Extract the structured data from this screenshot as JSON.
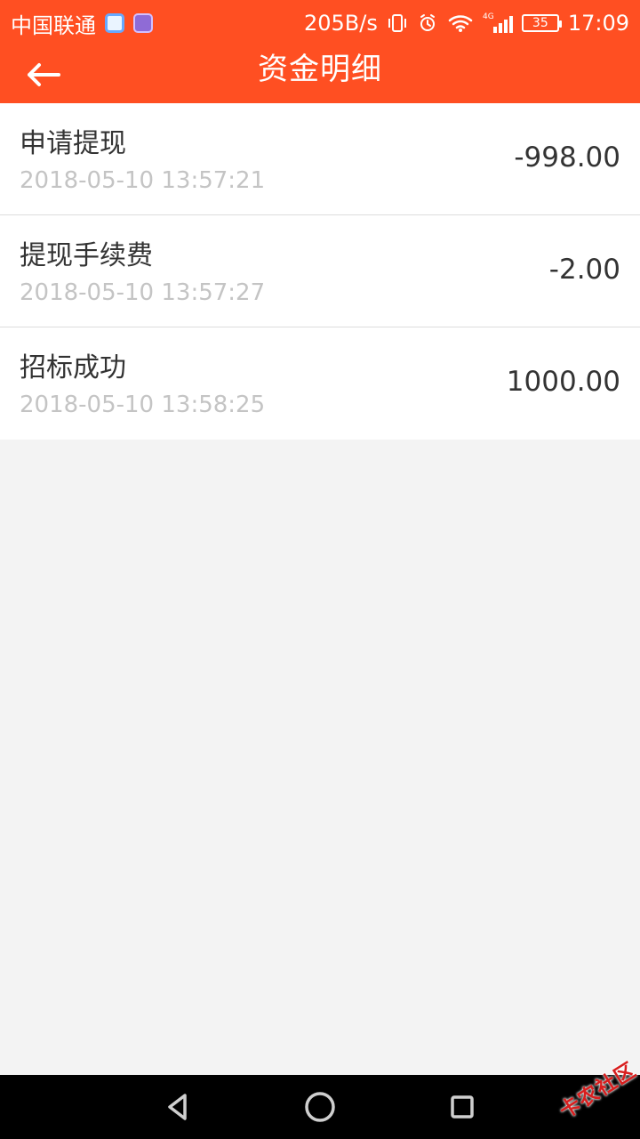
{
  "status_bar": {
    "carrier": "中国联通",
    "speed": "205B/s",
    "network": "4G",
    "battery": "35",
    "time": "17:09"
  },
  "app_bar": {
    "title": "资金明细"
  },
  "transactions": [
    {
      "title": "申请提现",
      "time": "2018-05-10 13:57:21",
      "amount": "-998.00"
    },
    {
      "title": "提现手续费",
      "time": "2018-05-10 13:57:27",
      "amount": "-2.00"
    },
    {
      "title": "招标成功",
      "time": "2018-05-10 13:58:25",
      "amount": "1000.00"
    }
  ],
  "watermark": {
    "text": "卡农社区"
  },
  "colors": {
    "accent": "#ff4f22",
    "secondary_text": "#c4c4c4",
    "background": "#f3f3f3"
  }
}
